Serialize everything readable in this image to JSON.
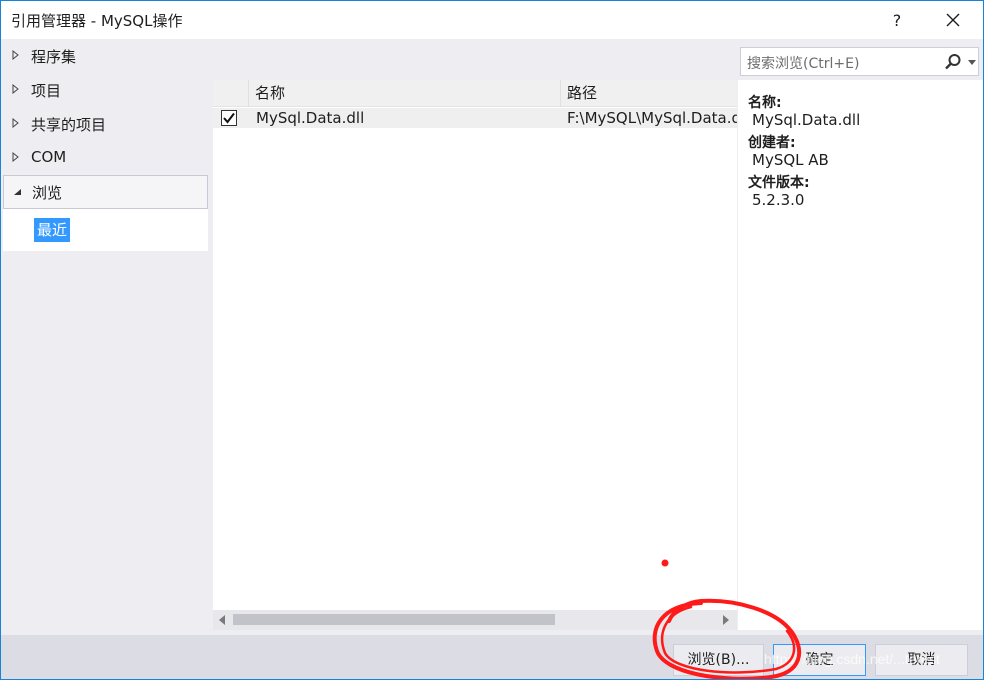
{
  "window": {
    "title": "引用管理器 - MySQL操作",
    "help_label": "?"
  },
  "nav": {
    "items": [
      {
        "label": "程序集"
      },
      {
        "label": "项目"
      },
      {
        "label": "共享的项目"
      },
      {
        "label": "COM"
      },
      {
        "label": "浏览"
      }
    ],
    "recent_label": "最近"
  },
  "search": {
    "placeholder": "搜索浏览(Ctrl+E)"
  },
  "table": {
    "columns": [
      "名称",
      "路径"
    ],
    "rows": [
      {
        "checked": true,
        "name": "MySql.Data.dll",
        "path": "F:\\MySQL\\MySql.Data.dll"
      }
    ]
  },
  "details": {
    "name_label": "名称:",
    "name_value": "MySql.Data.dll",
    "creator_label": "创建者:",
    "creator_value": "MySQL AB",
    "version_label": "文件版本:",
    "version_value": "5.2.3.0"
  },
  "buttons": {
    "browse": "浏览(B)...",
    "ok": "确定",
    "cancel": "取消"
  },
  "watermark": "https://blog.csdn.net/...terest",
  "colors": {
    "accent": "#3399ff",
    "annotation_red": "#ff1a1a"
  }
}
